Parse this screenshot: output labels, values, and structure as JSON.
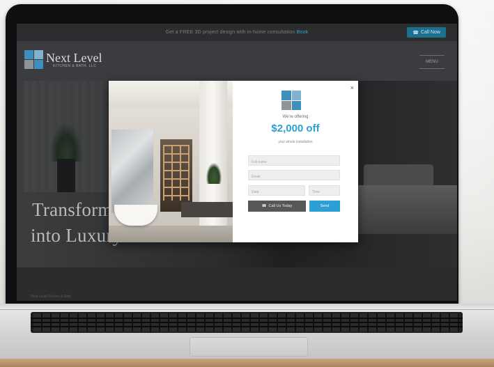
{
  "site": {
    "promo_bar": {
      "text": "Get a FREE 3D project design with in-home consultation",
      "link": "Book",
      "call_label": "Call Now"
    },
    "brand": {
      "name": "Next Level",
      "tagline": "KITCHEN & BATH, LLC"
    },
    "menu_label": "MENU",
    "hero": {
      "line1": "Transform",
      "line2": "into Luxury"
    },
    "footer_text": "Next Level Kitchen & Bath"
  },
  "popup": {
    "close_label": "×",
    "lead": "We're offering",
    "amount": "$2,000 off",
    "tail": "your whole installation",
    "fields": {
      "name_placeholder": "Full name",
      "email_placeholder": "Email",
      "date_placeholder": "Date",
      "time_placeholder": "Time"
    },
    "call_button": "Call Us Today",
    "send_button": "Send"
  },
  "colors": {
    "accent": "#2b9fd6",
    "logo_blue": "#3d8fc0",
    "logo_teal": "#7fb3cf",
    "logo_gray": "#8e9497"
  }
}
